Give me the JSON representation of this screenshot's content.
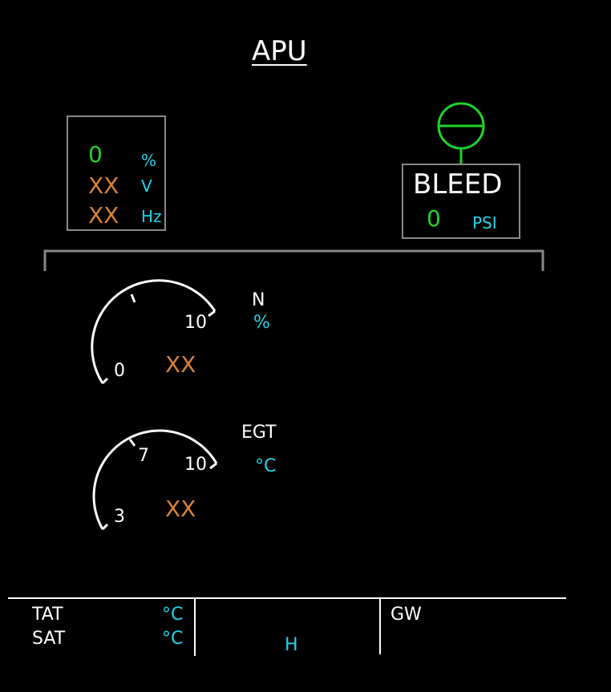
{
  "page": {
    "title": "APU"
  },
  "generator": {
    "load_value": "0",
    "load_unit": "%",
    "volt_value": "XX",
    "volt_unit": "V",
    "freq_value": "XX",
    "freq_unit": "Hz"
  },
  "bleed": {
    "label": "BLEED",
    "pressure_value": "0",
    "pressure_unit": "PSI"
  },
  "n_gauge": {
    "label": "N",
    "unit": "%",
    "value": "XX",
    "tick_min": "0",
    "tick_max": "10"
  },
  "egt_gauge": {
    "label": "EGT",
    "unit": "°C",
    "value": "XX",
    "tick_min": "3",
    "tick_mid": "7",
    "tick_max": "10"
  },
  "footer": {
    "tat_label": "TAT",
    "tat_unit": "°C",
    "sat_label": "SAT",
    "sat_unit": "°C",
    "center_label": "H",
    "gw_label": "GW"
  },
  "colors": {
    "background": "#000000",
    "value_green": "#1fd32a",
    "value_amber": "#d9823a",
    "unit_cyan": "#23d3e8",
    "frame_grey": "#8a8a8a"
  }
}
